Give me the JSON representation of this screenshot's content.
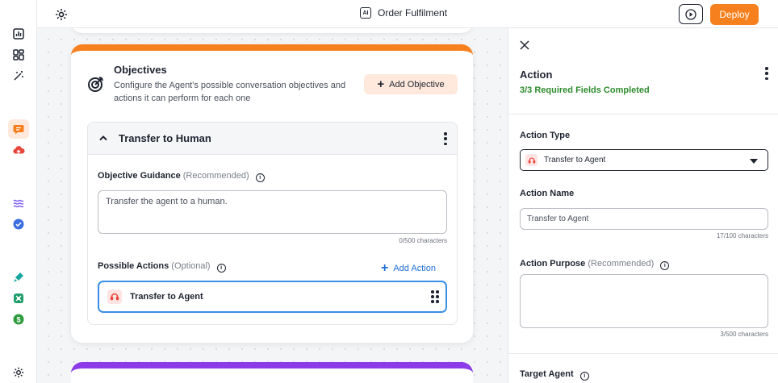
{
  "app": {
    "title": "Order Fulfilment",
    "ai_badge": "AI",
    "deploy_label": "Deploy"
  },
  "colors": {
    "accent": "#f7801e",
    "link": "#1d6fd6",
    "success": "#2e8b2e",
    "selected_border": "#3a8ee6",
    "next_card": "#8b3be8"
  },
  "rail": {
    "items": [
      "analytics-icon",
      "dashboard-icon",
      "magic-wand-icon",
      "chat-icon",
      "cloud-upload-icon",
      "waves-icon",
      "verified-icon",
      "brush-icon",
      "integrations-icon",
      "billing-icon",
      "settings-icon"
    ]
  },
  "objectives": {
    "title": "Objectives",
    "description": "Configure the Agent's possible conversation objectives and actions it can perform for each one",
    "add_button": "Add Objective",
    "item": {
      "title": "Transfer to Human",
      "guidance_label": "Objective Guidance",
      "guidance_hint": "(Recommended)",
      "guidance_value": "Transfer the agent to a human.",
      "guidance_counter": "0/500 characters",
      "actions_label": "Possible Actions",
      "actions_hint": "(Optional)",
      "add_action": "Add Action",
      "actions": [
        {
          "label": "Transfer to Agent"
        }
      ]
    }
  },
  "panel": {
    "title": "Action",
    "status": "3/3 Required Fields Completed",
    "action_type_label": "Action Type",
    "action_type_value": "Transfer to Agent",
    "action_name_label": "Action Name",
    "action_name_value": "Transfer to Agent",
    "action_name_counter": "17/100 characters",
    "action_purpose_label": "Action Purpose",
    "action_purpose_hint": "(Recommended)",
    "action_purpose_value": "",
    "action_purpose_counter": "3/500 characters",
    "target_agent_label": "Target Agent"
  }
}
